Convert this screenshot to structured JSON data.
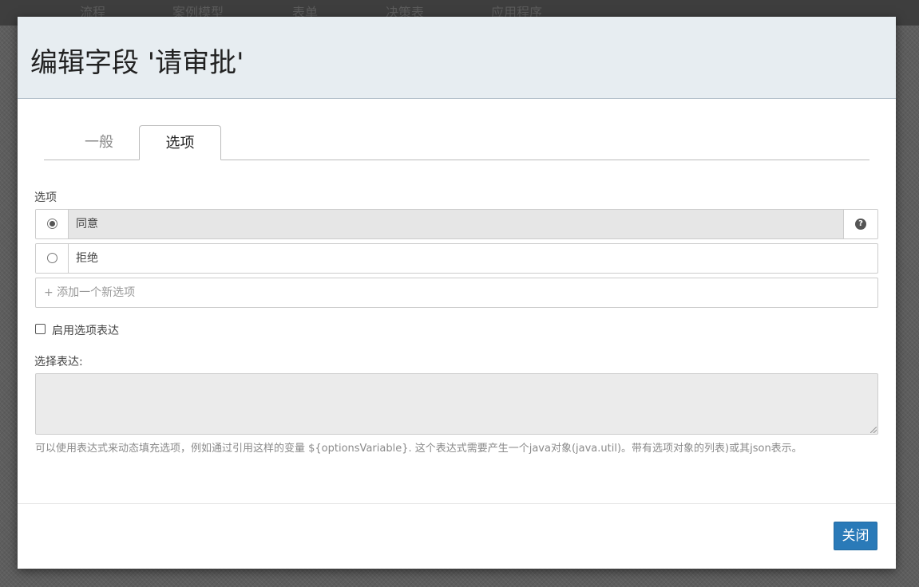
{
  "background_nav": {
    "items": [
      "流程",
      "案例模型",
      "表单",
      "决策表",
      "应用程序"
    ]
  },
  "modal": {
    "title": "编辑字段 '请审批'",
    "tabs": [
      {
        "label": "一般",
        "active": false
      },
      {
        "label": "选项",
        "active": true
      }
    ],
    "options_section": {
      "label": "选项",
      "options": [
        {
          "label": "同意",
          "selected": true
        },
        {
          "label": "拒绝",
          "selected": false
        }
      ],
      "add_option_placeholder": "+ 添加一个新选项"
    },
    "enable_expression": {
      "label": "启用选项表达",
      "checked": false
    },
    "expression": {
      "label": "选择表达:",
      "value": "",
      "help_text": "可以使用表达式来动态填充选项，例如通过引用这样的变量 ${optionsVariable}. 这个表达式需要产生一个java对象(java.util)。带有选项对象的列表)或其json表示。"
    },
    "footer": {
      "close_label": "关闭"
    }
  },
  "colors": {
    "header_bg": "#e7edf1",
    "primary_button": "#2a7ab8",
    "selected_row_bg": "#e6e6e6"
  },
  "icons": {
    "option_help": "question-circle-icon"
  }
}
